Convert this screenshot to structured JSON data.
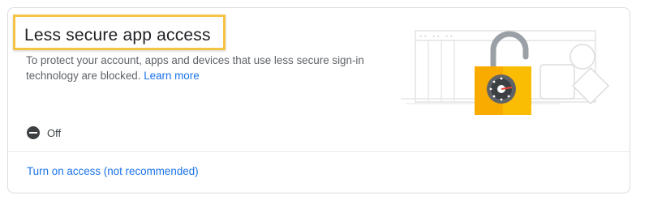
{
  "card": {
    "title": "Less secure app access",
    "description": "To protect your account, apps and devices that use less secure sign-in technology are blocked.",
    "learn_more": "Learn more",
    "status_label": "Off",
    "action_link": "Turn on access (not recommended)"
  },
  "colors": {
    "highlight": "#f5c344",
    "link": "#1a73e8",
    "text_primary": "#202124",
    "text_secondary": "#5f6368",
    "lock_body": "#f9ab00",
    "lock_shackle": "#9aa0a6"
  },
  "icons": {
    "status": "minus-circle-icon",
    "illustration": "padlock-unlocked-icon"
  }
}
